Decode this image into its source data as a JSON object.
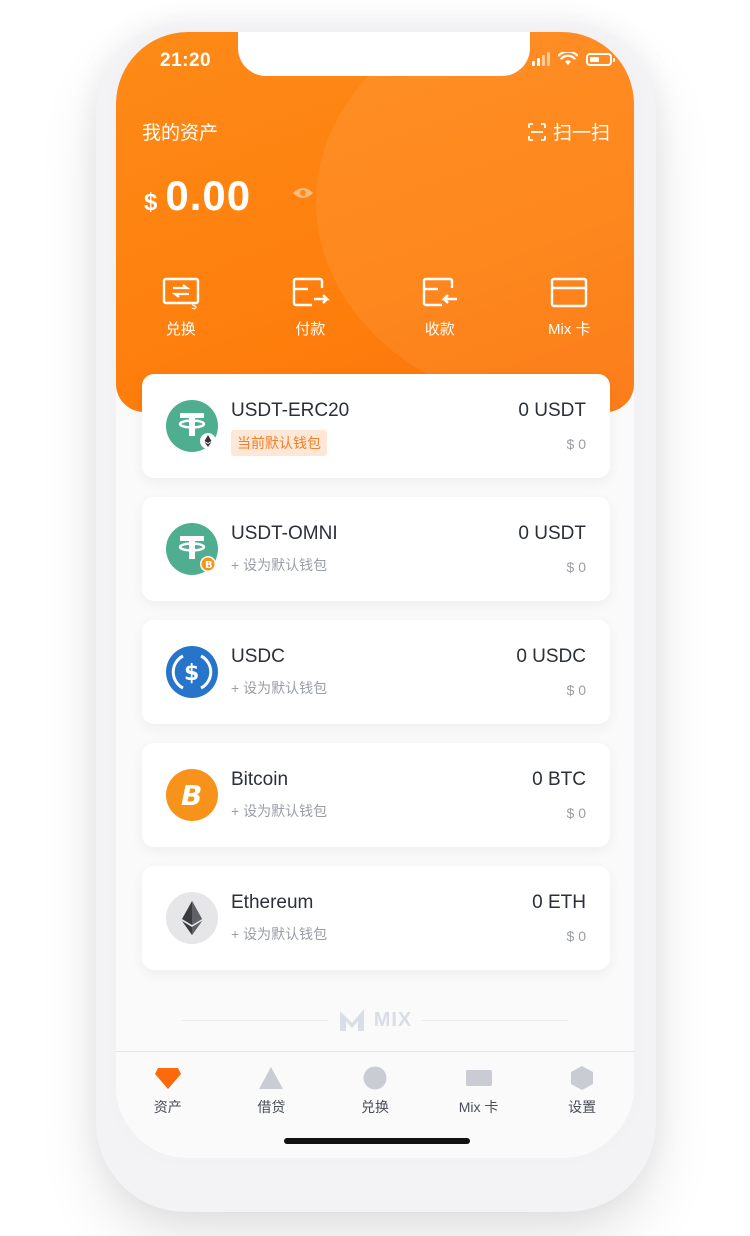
{
  "status_bar": {
    "time": "21:20"
  },
  "header": {
    "title": "我的资产",
    "scan_label": "扫一扫"
  },
  "balance": {
    "currency_symbol": "$",
    "amount": "0.00"
  },
  "actions": [
    {
      "label": "兑换",
      "icon": "exchange-icon"
    },
    {
      "label": "付款",
      "icon": "pay-icon"
    },
    {
      "label": "收款",
      "icon": "receive-icon"
    },
    {
      "label": "Mix 卡",
      "icon": "card-icon"
    }
  ],
  "wallets": [
    {
      "name": "USDT-ERC20",
      "sub": "当前默认钱包",
      "is_default": true,
      "amount": "0 USDT",
      "fiat": "$ 0",
      "icon": "tether-eth-icon"
    },
    {
      "name": "USDT-OMNI",
      "sub": "+ 设为默认钱包",
      "is_default": false,
      "amount": "0 USDT",
      "fiat": "$ 0",
      "icon": "tether-btc-icon"
    },
    {
      "name": "USDC",
      "sub": "+ 设为默认钱包",
      "is_default": false,
      "amount": "0 USDC",
      "fiat": "$ 0",
      "icon": "usdc-icon"
    },
    {
      "name": "Bitcoin",
      "sub": "+ 设为默认钱包",
      "is_default": false,
      "amount": "0 BTC",
      "fiat": "$ 0",
      "icon": "bitcoin-icon"
    },
    {
      "name": "Ethereum",
      "sub": "+ 设为默认钱包",
      "is_default": false,
      "amount": "0 ETH",
      "fiat": "$ 0",
      "icon": "ethereum-icon"
    }
  ],
  "footer": {
    "brand": "MIX"
  },
  "tabbar": [
    {
      "label": "资产",
      "icon": "diamond-icon",
      "active": true
    },
    {
      "label": "借贷",
      "icon": "triangle-icon",
      "active": false
    },
    {
      "label": "兑换",
      "icon": "circle-icon",
      "active": false
    },
    {
      "label": "Mix 卡",
      "icon": "card-icon",
      "active": false
    },
    {
      "label": "设置",
      "icon": "hexagon-icon",
      "active": false
    }
  ],
  "colors": {
    "brand_orange": "#fe7f0d",
    "tether_green": "#4fae8f",
    "usdc_blue": "#2775ca",
    "bitcoin_orange": "#f7931a",
    "tab_inactive": "#c9ccd3",
    "default_tag_bg": "#fde7d6"
  }
}
